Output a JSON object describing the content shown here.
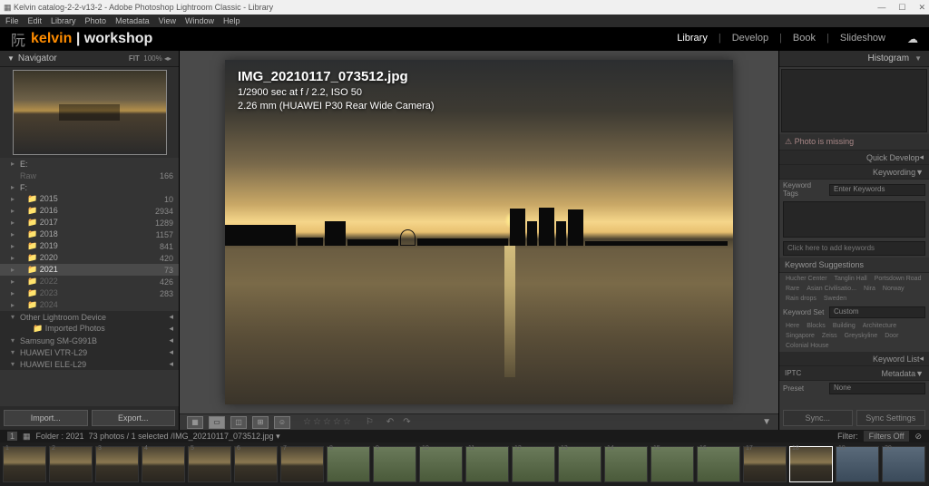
{
  "window": {
    "title": "Kelvin catalog-2-2-v13-2 - Adobe Photoshop Lightroom Classic - Library"
  },
  "menu": [
    "File",
    "Edit",
    "Library",
    "Photo",
    "Metadata",
    "View",
    "Window",
    "Help"
  ],
  "brand": {
    "k": "kelvin",
    "w": " | workshop"
  },
  "modules": [
    "Library",
    "Develop",
    "Book",
    "Slideshow"
  ],
  "active_module": "Library",
  "navigator": {
    "label": "Navigator",
    "fit": "FIT",
    "levels": "100%"
  },
  "folders_top": [
    {
      "exp": "▸",
      "name": "E:",
      "cnt": ""
    },
    {
      "exp": "",
      "name": "Raw",
      "cnt": "166",
      "dim": true
    },
    {
      "exp": "▸",
      "name": "F:",
      "cnt": ""
    }
  ],
  "folders_years": [
    {
      "name": "2015",
      "cnt": "10"
    },
    {
      "name": "2016",
      "cnt": "2934"
    },
    {
      "name": "2017",
      "cnt": "1289"
    },
    {
      "name": "2018",
      "cnt": "1157"
    },
    {
      "name": "2019",
      "cnt": "841"
    },
    {
      "name": "2020",
      "cnt": "420"
    },
    {
      "name": "2021",
      "cnt": "73",
      "sel": true
    },
    {
      "name": "2022",
      "cnt": "426",
      "dim": true
    },
    {
      "name": "2023",
      "cnt": "283",
      "dim": true
    },
    {
      "name": "2024",
      "cnt": "",
      "dim": true
    }
  ],
  "folder_sections": [
    {
      "name": "Other Lightroom Device"
    },
    {
      "name": "Imported Photos",
      "indent": true
    },
    {
      "name": "Samsung SM-G991B"
    },
    {
      "name": "HUAWEI VTR-L29"
    },
    {
      "name": "HUAWEI ELE-L29"
    }
  ],
  "buttons": {
    "import": "Import...",
    "export": "Export..."
  },
  "photo": {
    "filename": "IMG_20210117_073512.jpg",
    "exposure": "1/2900 sec at f / 2.2, ISO 50",
    "lens": "2.26 mm (HUAWEI P30 Rear Wide Camera)"
  },
  "right": {
    "histogram": "Histogram",
    "missing": "⚠ Photo is missing",
    "quickdev": "Quick Develop",
    "keywording": "Keywording",
    "kw_tags": "Keyword Tags",
    "kw_enter": "Enter Keywords",
    "kw_click": "Click here to add keywords",
    "kw_sugg_label": "Keyword Suggestions",
    "kw_sugg": [
      "Hucher Center",
      "Tanglin Hall",
      "Portsdown Road",
      "Rare",
      "Asian Civilisatio...",
      "Nira",
      "Norway",
      "Rain drops",
      "Sweden"
    ],
    "kw_set": "Keyword Set",
    "kw_set_val": "Custom",
    "kw_set_items": [
      "Here",
      "Blocks",
      "Building",
      "Architecture",
      "Singapore",
      "Zeiss",
      "Greyskyline",
      "Door",
      "Colonial House"
    ],
    "kw_list": "Keyword List",
    "metadata": "Metadata",
    "metadata_mode": "IPTC",
    "preset": "Preset",
    "preset_val": "None",
    "sync": "Sync...",
    "sync_settings": "Sync Settings"
  },
  "filmbar": {
    "folder": "Folder : 2021",
    "count": "73 photos / 1 selected /",
    "current": "IMG_20210117_073512.jpg",
    "filter": "Filter:",
    "filters_off": "Filters Off"
  },
  "thumbs": 20
}
